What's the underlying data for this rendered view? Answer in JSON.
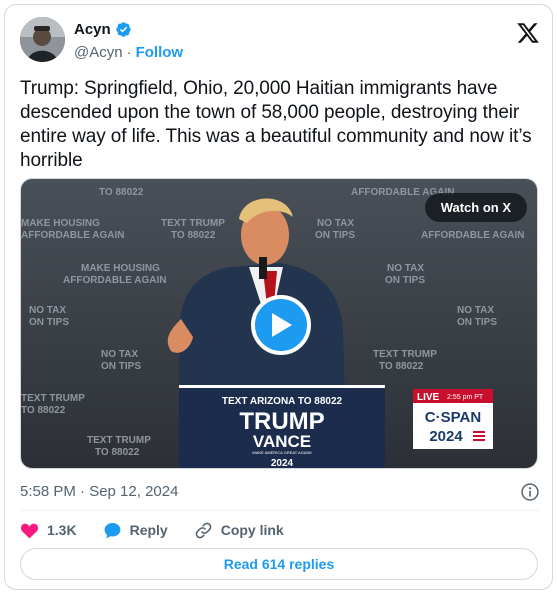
{
  "author": {
    "name": "Acyn",
    "handle": "@Acyn",
    "separator": "·",
    "follow_label": "Follow"
  },
  "tweet": {
    "text": "Trump: Springfield, Ohio, 20,000 Haitian immigrants have descended upon the town of 58,000 people, destroying their entire way of life. This was a beautiful community and now it’s horrible",
    "timestamp": "5:58 PM · Sep 12, 2024"
  },
  "media": {
    "watch_label": "Watch on X",
    "backdrop_signs": [
      "TEXT TRUMP",
      "TO 88022",
      "NO TAX",
      "ON TIPS",
      "MAKE HOUSING",
      "AFFORDABLE AGAIN"
    ],
    "podium": {
      "top_line": "TEXT ARIZONA TO 88022",
      "big1": "TRUMP",
      "big2": "VANCE",
      "tag": "MAKE AMERICA GREAT AGAIN!",
      "year": "2024"
    },
    "broadcast": {
      "live": "LIVE",
      "time": "2:55 pm PT",
      "network": "C·SPAN",
      "year": "2024"
    }
  },
  "actions": {
    "likes": "1.3K",
    "reply_label": "Reply",
    "copy_label": "Copy link"
  },
  "replies_button": "Read 614 replies",
  "colors": {
    "accent": "#1d9bf0",
    "like": "#f91880",
    "muted": "#536471",
    "text": "#0f1419"
  }
}
